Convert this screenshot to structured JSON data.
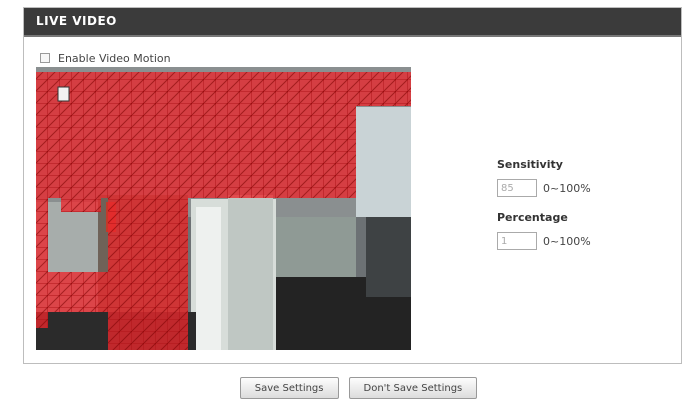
{
  "header": {
    "title": "LIVE VIDEO"
  },
  "motion": {
    "enable_label": "Enable Video Motion",
    "enabled": false
  },
  "sensitivity": {
    "label": "Sensitivity",
    "value": "85",
    "range": "0~100%"
  },
  "percentage": {
    "label": "Percentage",
    "value": "1",
    "range": "0~100%"
  },
  "buttons": {
    "save": "Save Settings",
    "dont_save": "Don't Save Settings"
  },
  "colors": {
    "grid_red": "#e0262b",
    "header_bg": "#3b3b3b"
  }
}
